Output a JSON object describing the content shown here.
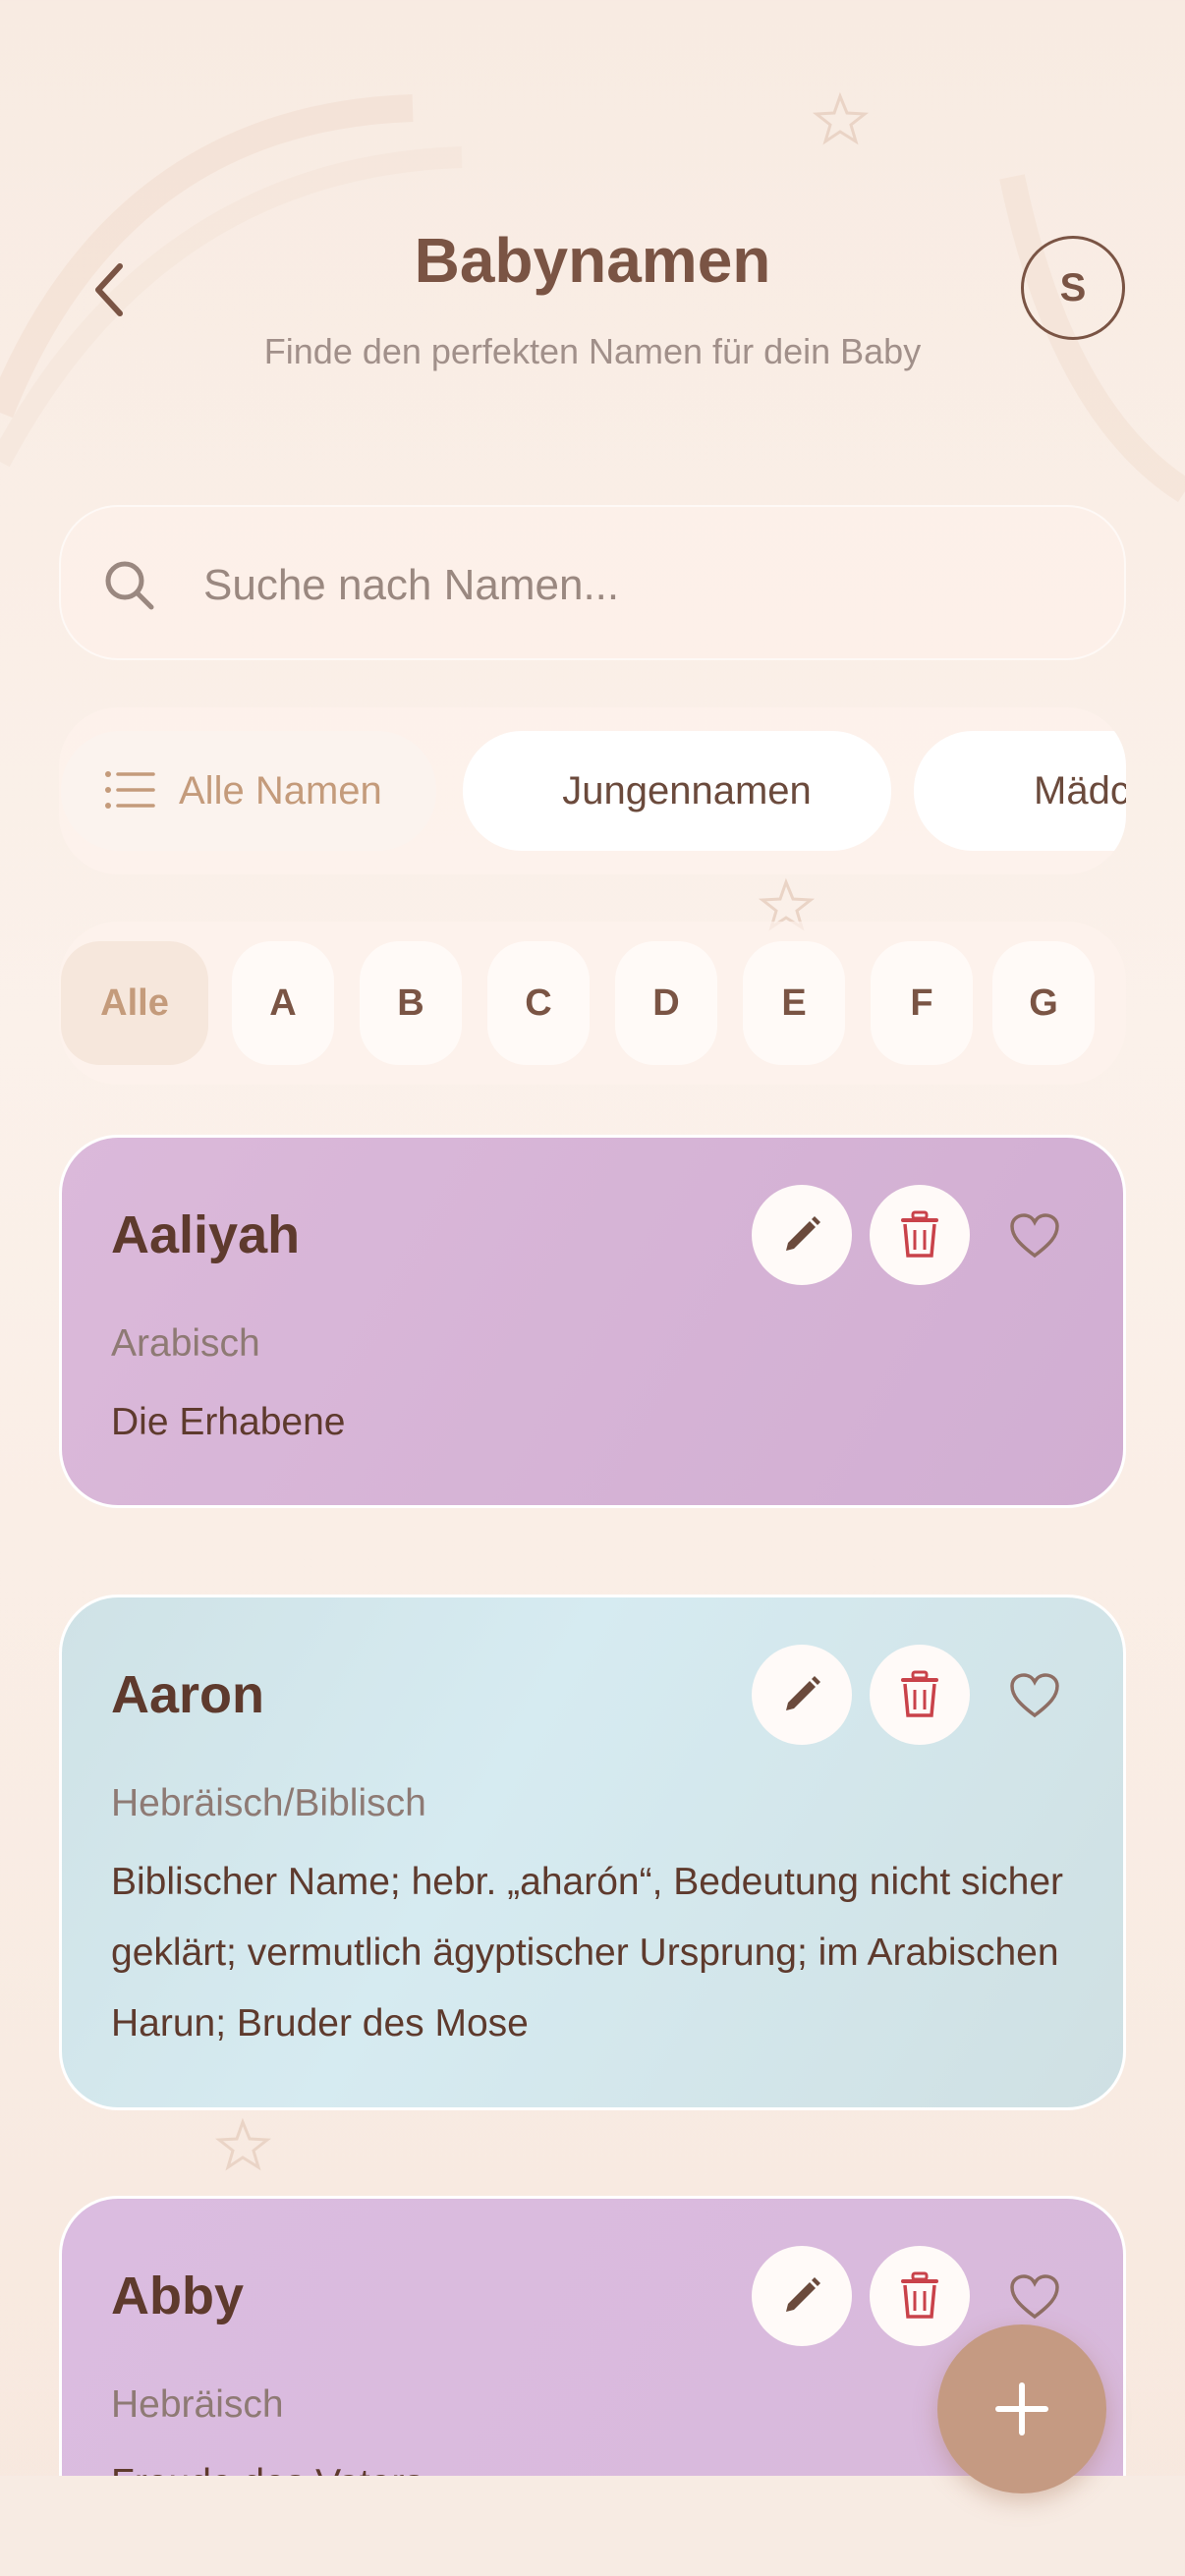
{
  "header": {
    "title": "Babynamen",
    "subtitle": "Finde den perfekten Namen für dein Baby",
    "avatar_initial": "S"
  },
  "search": {
    "placeholder": "Suche nach Namen..."
  },
  "filters": [
    {
      "label": "Alle Namen",
      "selected": true
    },
    {
      "label": "Jungennamen",
      "selected": false
    },
    {
      "label": "Mädchennamen",
      "visible_text": "Mädc",
      "selected": false
    }
  ],
  "letters": [
    "Alle",
    "A",
    "B",
    "C",
    "D",
    "E",
    "F",
    "G"
  ],
  "cards": [
    {
      "name": "Aaliyah",
      "origin": "Arabisch",
      "meaning": "Die Erhabene",
      "color": "#d6b4d6"
    },
    {
      "name": "Aaron",
      "origin": "Hebräisch/Biblisch",
      "meaning": "Biblischer Name; hebr. „aharón“, Bedeutung nicht sicher geklärt; vermutlich ägyptischer Ursprung; im Arabischen Harun; Bruder des Mose",
      "color": "#d3e6ea"
    },
    {
      "name": "Abby",
      "origin": "Hebräisch",
      "meaning": "Freude des Vaters",
      "color": "#dabbdd"
    }
  ],
  "colors": {
    "accent": "#c59a82",
    "title": "#7a5444",
    "delete_icon": "#c9424a"
  },
  "icons": {
    "back": "chevron-left-icon",
    "search": "search-icon",
    "list": "list-icon",
    "edit": "pencil-icon",
    "delete": "trash-icon",
    "favorite": "heart-outline-icon",
    "add": "plus-icon"
  }
}
